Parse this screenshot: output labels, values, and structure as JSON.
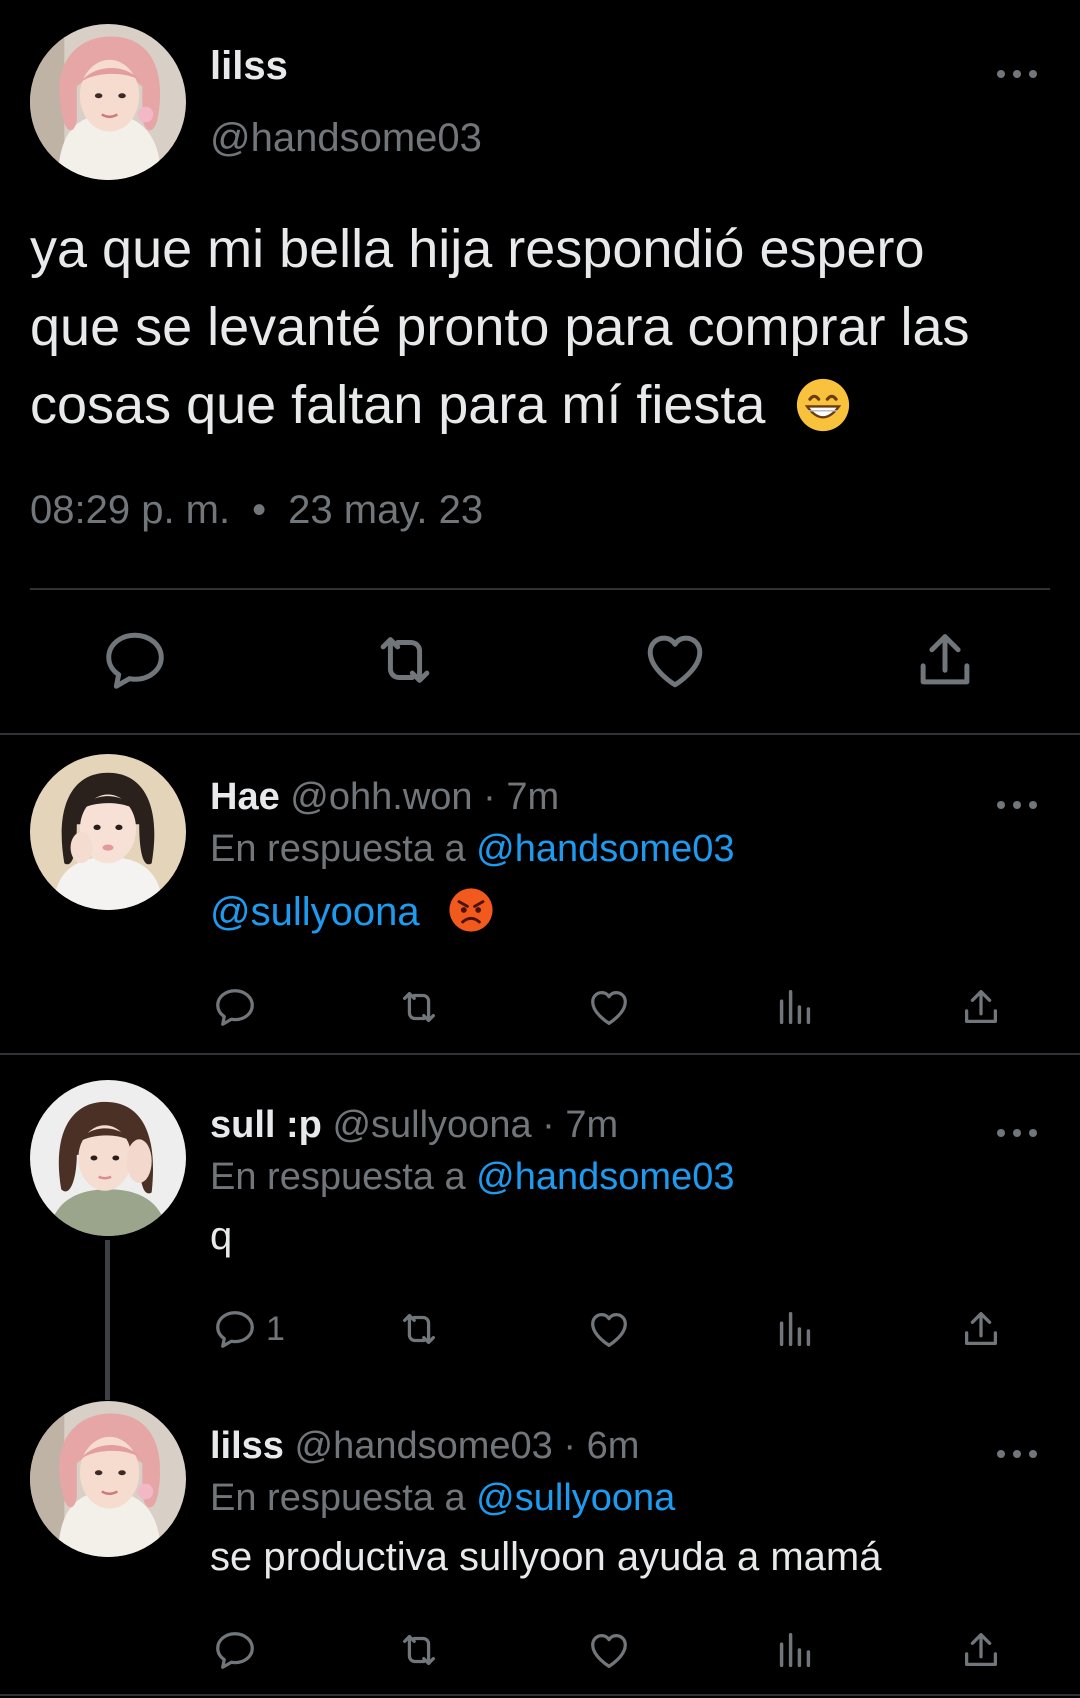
{
  "main_tweet": {
    "name": "lilss",
    "handle": "@handsome03",
    "text_line1": "ya que mi bella hija respondió espero",
    "text_line2": "que se levanté pronto para comprar las",
    "text_line3": "cosas que faltan para mí fiesta",
    "emoji": "grinning-face-with-smiling-eyes",
    "time": "08:29 p. m.",
    "separator": "•",
    "date": "23 may. 23",
    "actions": [
      "reply-icon",
      "retweet-icon",
      "like-icon",
      "share-icon"
    ]
  },
  "replies": [
    {
      "name": "Hae",
      "handle": "@ohh.won",
      "sep": "·",
      "time": "7m",
      "replying_prefix": "En respuesta a",
      "replying_to": "@handsome03",
      "text_mention": "@sullyoona",
      "emoji": "angry-face",
      "reply_count": ""
    },
    {
      "name": "sull :p",
      "handle": "@sullyoona",
      "sep": "·",
      "time": "7m",
      "replying_prefix": "En respuesta a",
      "replying_to": "@handsome03",
      "text": "q",
      "reply_count": "1"
    },
    {
      "name": "lilss",
      "handle": "@handsome03",
      "sep": "·",
      "time": "6m",
      "replying_prefix": "En respuesta a",
      "replying_to": "@sullyoona",
      "text": "se productiva sullyoon ayuda a mamá",
      "reply_count": ""
    }
  ],
  "colors": {
    "background": "#000000",
    "text": "#e7e9ea",
    "muted": "#71767b",
    "link": "#1d9bf0",
    "divider": "#2f3336"
  }
}
